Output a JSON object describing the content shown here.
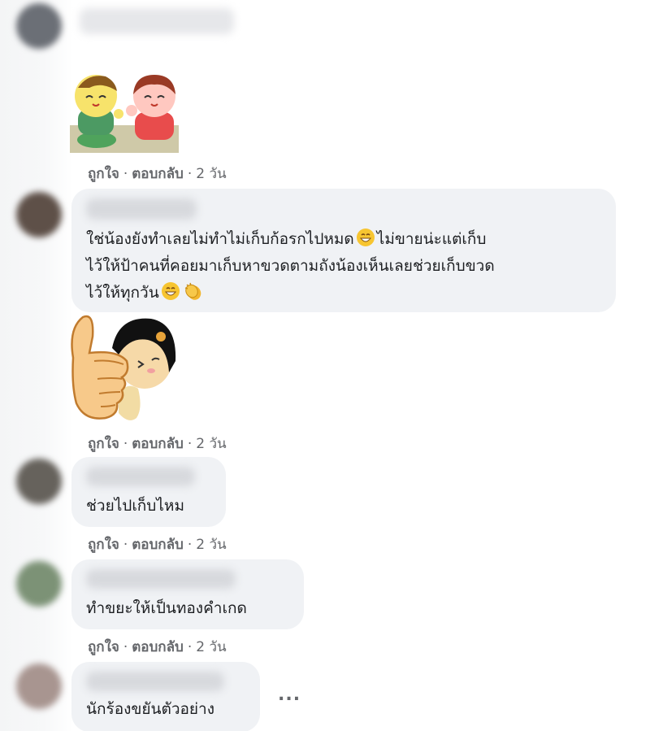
{
  "comments": [
    {
      "text_lines": [],
      "meta": {
        "like": "ถูกใจ",
        "reply": "ตอบกลับ",
        "time": "2 วัน"
      },
      "sticker": "two-kids-sticker"
    },
    {
      "text_lines": [
        "ใช่น้องยังทำเลยไม่ทำไม่เก็บก้อรกไปหมด",
        "ไม่ขายน่ะแต่เก็บ",
        "ไว้ให้ป้าคนที่คอยมาเก็บหาขวดตามถังน้องเห็นเลยช่วยเก็บขวด",
        "ไว้ให้ทุกวัน"
      ],
      "emojis": [
        "grinning-face",
        "grinning-face",
        "clapping-hands"
      ],
      "meta": {
        "like": "ถูกใจ",
        "reply": "ตอบกลับ",
        "time": "2 วัน"
      },
      "sticker": "thumbs-up-girl-sticker"
    },
    {
      "text_lines": [
        "ช่วยไปเก็บไหม"
      ],
      "meta": {
        "like": "ถูกใจ",
        "reply": "ตอบกลับ",
        "time": "2 วัน"
      }
    },
    {
      "text_lines": [
        "ทำขยะให้เป็นทองคำเกด"
      ],
      "meta": {
        "like": "ถูกใจ",
        "reply": "ตอบกลับ",
        "time": "2 วัน"
      }
    },
    {
      "text_lines": [
        "นักร้องขยันตัวอย่าง"
      ]
    }
  ],
  "more_label": "...",
  "meta_separator": "·",
  "colors": {
    "bubble": "#f0f2f5",
    "meta_text": "#65676b",
    "text": "#1c1e21"
  }
}
